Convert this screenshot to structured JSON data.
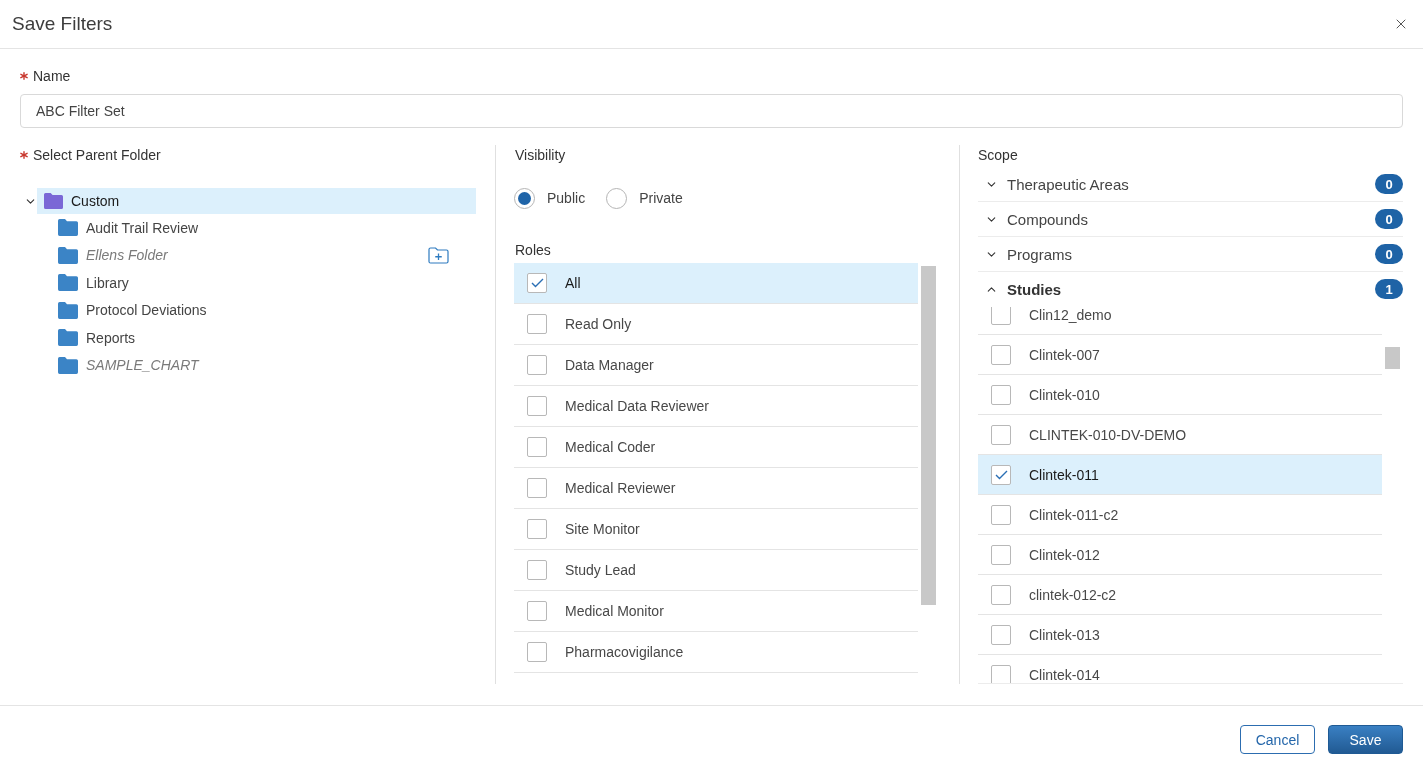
{
  "dialog": {
    "title": "Save Filters"
  },
  "name": {
    "label": "Name",
    "required": true,
    "value": "ABC Filter Set"
  },
  "parent_folder": {
    "label": "Select Parent Folder",
    "required": true,
    "tree": [
      {
        "name": "Custom",
        "color": "#7a67d6",
        "expanded": true,
        "selected": true,
        "dimmed": false,
        "hovered": false,
        "children": [
          {
            "name": "Audit Trail Review",
            "color": "#3b84c6",
            "selected": false,
            "dimmed": false,
            "hovered": false
          },
          {
            "name": "Ellens Folder",
            "color": "#3b84c6",
            "selected": false,
            "dimmed": true,
            "hovered": true
          },
          {
            "name": "Library",
            "color": "#3b84c6",
            "selected": false,
            "dimmed": false,
            "hovered": false
          },
          {
            "name": "Protocol Deviations",
            "color": "#3b84c6",
            "selected": false,
            "dimmed": false,
            "hovered": false
          },
          {
            "name": "Reports",
            "color": "#3b84c6",
            "selected": false,
            "dimmed": false,
            "hovered": false
          },
          {
            "name": "SAMPLE_CHART",
            "color": "#3b84c6",
            "selected": false,
            "dimmed": true,
            "hovered": false
          }
        ]
      }
    ]
  },
  "visibility": {
    "label": "Visibility",
    "options": [
      {
        "label": "Public",
        "selected": true
      },
      {
        "label": "Private",
        "selected": false
      }
    ]
  },
  "roles": {
    "label": "Roles",
    "items": [
      {
        "label": "All",
        "checked": true
      },
      {
        "label": "Read Only",
        "checked": false
      },
      {
        "label": "Data Manager",
        "checked": false
      },
      {
        "label": "Medical Data Reviewer",
        "checked": false
      },
      {
        "label": "Medical Coder",
        "checked": false
      },
      {
        "label": "Medical Reviewer",
        "checked": false
      },
      {
        "label": "Site Monitor",
        "checked": false
      },
      {
        "label": "Study Lead",
        "checked": false
      },
      {
        "label": "Medical Monitor",
        "checked": false
      },
      {
        "label": "Pharmacovigilance",
        "checked": false
      }
    ]
  },
  "scope": {
    "label": "Scope",
    "sections": [
      {
        "title": "Therapeutic Areas",
        "count": "0",
        "expanded": false
      },
      {
        "title": "Compounds",
        "count": "0",
        "expanded": false
      },
      {
        "title": "Programs",
        "count": "0",
        "expanded": false
      },
      {
        "title": "Studies",
        "count": "1",
        "expanded": true,
        "items": [
          {
            "label": "Clin12_demo",
            "checked": false
          },
          {
            "label": "Clintek-007",
            "checked": false
          },
          {
            "label": "Clintek-010",
            "checked": false
          },
          {
            "label": "CLINTEK-010-DV-DEMO",
            "checked": false
          },
          {
            "label": "Clintek-011",
            "checked": true
          },
          {
            "label": "Clintek-011-c2",
            "checked": false
          },
          {
            "label": "Clintek-012",
            "checked": false
          },
          {
            "label": "clintek-012-c2",
            "checked": false
          },
          {
            "label": "Clintek-013",
            "checked": false
          },
          {
            "label": "Clintek-014",
            "checked": false
          }
        ]
      }
    ]
  },
  "footer": {
    "buttons": [
      {
        "label": "Cancel",
        "kind": "secondary"
      },
      {
        "label": "Save",
        "kind": "primary"
      }
    ]
  }
}
